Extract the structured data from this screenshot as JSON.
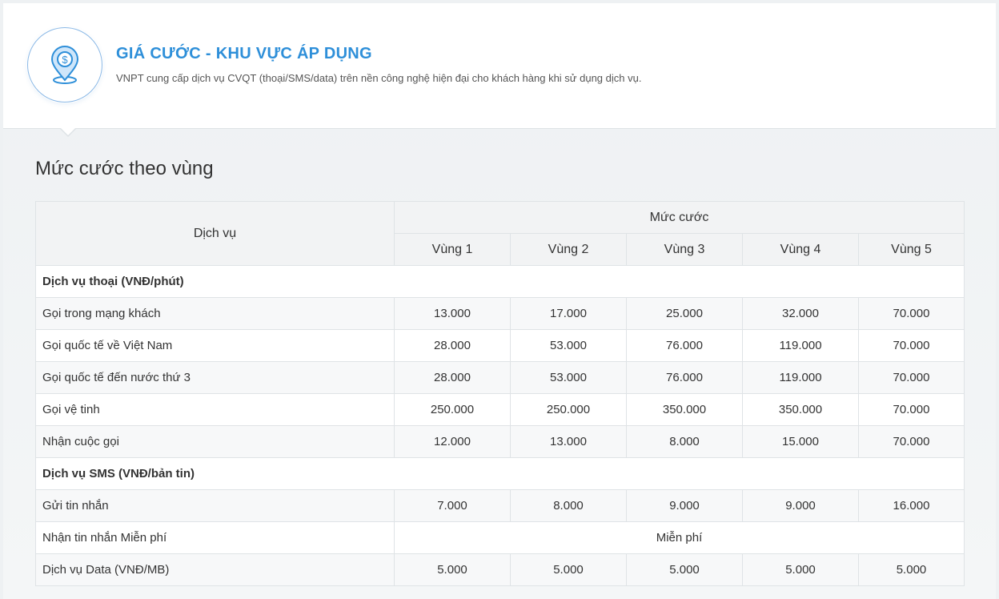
{
  "header": {
    "title": "GIÁ CƯỚC - KHU VỰC ÁP DỤNG",
    "subtitle": "VNPT cung cấp dịch vụ CVQT (thoại/SMS/data) trên nền công nghệ hiện đại cho khách hàng khi sử dụng dịch vụ.",
    "icon": "location-dollar-icon",
    "accent_color": "#2e8fd9"
  },
  "section": {
    "title": "Mức cước theo vùng"
  },
  "table": {
    "service_header": "Dịch vụ",
    "rate_header": "Mức cước",
    "zones": [
      "Vùng 1",
      "Vùng 2",
      "Vùng 3",
      "Vùng 4",
      "Vùng 5"
    ],
    "voice_group": "Dịch vụ thoại (VNĐ/phút)",
    "voice_rows": [
      {
        "service": "Gọi trong mạng khách",
        "values": [
          "13.000",
          "17.000",
          "25.000",
          "32.000",
          "70.000"
        ]
      },
      {
        "service": "Gọi quốc tế về Việt Nam",
        "values": [
          "28.000",
          "53.000",
          "76.000",
          "119.000",
          "70.000"
        ]
      },
      {
        "service": "Gọi quốc tế đến nước thứ 3",
        "values": [
          "28.000",
          "53.000",
          "76.000",
          "119.000",
          "70.000"
        ]
      },
      {
        "service": "Gọi vệ tinh",
        "values": [
          "250.000",
          "250.000",
          "350.000",
          "350.000",
          "70.000"
        ]
      },
      {
        "service": "Nhận cuộc gọi",
        "values": [
          "12.000",
          "13.000",
          "8.000",
          "15.000",
          "70.000"
        ]
      }
    ],
    "sms_group": "Dịch vụ SMS (VNĐ/bản tin)",
    "sms_send": {
      "service": "Gửi tin nhắn",
      "values": [
        "7.000",
        "8.000",
        "9.000",
        "9.000",
        "16.000"
      ]
    },
    "sms_receive": {
      "service": "Nhận tin nhắn Miễn phí",
      "value": "Miễn phí"
    },
    "data_row": {
      "service": "Dịch vụ Data (VNĐ/MB)",
      "values": [
        "5.000",
        "5.000",
        "5.000",
        "5.000",
        "5.000"
      ]
    }
  }
}
